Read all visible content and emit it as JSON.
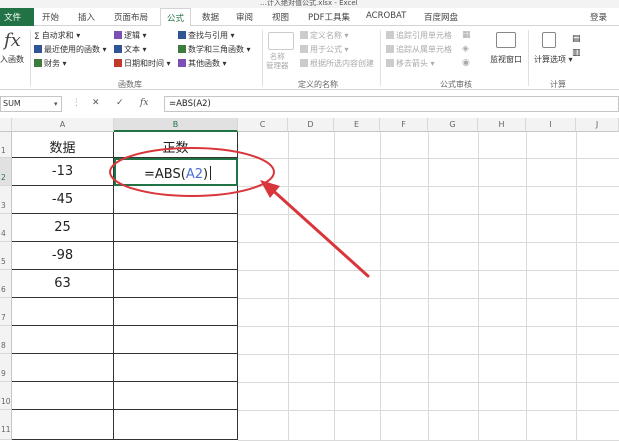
{
  "window": {
    "title": "…计入绝对值公式.xlsx - Excel"
  },
  "ribbon_tabs": [
    "文件",
    "开始",
    "插入",
    "页面布局",
    "公式",
    "数据",
    "审阅",
    "视图",
    "PDF工具集",
    "ACROBAT",
    "百度网盘"
  ],
  "active_tab": "公式",
  "login_label": "登录",
  "ribbon": {
    "insert_function": "入函数",
    "fx_symbol": "fx",
    "library": {
      "autosum": "自动求和",
      "recent": "最近使用的函数",
      "financial": "财务",
      "logical": "逻辑",
      "text": "文本",
      "datetime": "日期和时间",
      "lookup": "查找与引用",
      "math": "数学和三角函数",
      "other": "其他函数",
      "group_label": "函数库"
    },
    "names": {
      "name_manager": "名称\n管理器",
      "define_name": "定义名称",
      "use_in_formula": "用于公式",
      "create_from_selection": "根据所选内容创建",
      "group_label": "定义的名称"
    },
    "audit": {
      "trace_precedents": "追踪引用单元格",
      "trace_dependents": "追踪从属单元格",
      "remove_arrows": "移去箭头",
      "watch_window": "监视窗口",
      "group_label": "公式审核"
    },
    "calc": {
      "calc_options": "计算选项",
      "group_label": "计算"
    }
  },
  "formula_bar": {
    "name_box": "SUM",
    "cancel_icon": "✕",
    "enter_icon": "✓",
    "fx_label": "fx",
    "formula": "=ABS(A2)"
  },
  "columns": [
    "A",
    "B",
    "C",
    "D",
    "E",
    "F",
    "G",
    "H",
    "I",
    "J"
  ],
  "rows": [
    "1",
    "2",
    "3",
    "4",
    "5",
    "6",
    "7",
    "8",
    "9",
    "10",
    "11"
  ],
  "cells": {
    "A1": "数据",
    "B1": "正数",
    "A2": "-13",
    "A3": "-45",
    "A4": "25",
    "A5": "-98",
    "A6": "63",
    "B2_prefix": "=ABS(",
    "B2_ref": "A2",
    "B2_suffix": ")"
  },
  "colors": {
    "accent": "#217346",
    "annotation": "#d9363b",
    "ref": "#4a6fd1"
  }
}
